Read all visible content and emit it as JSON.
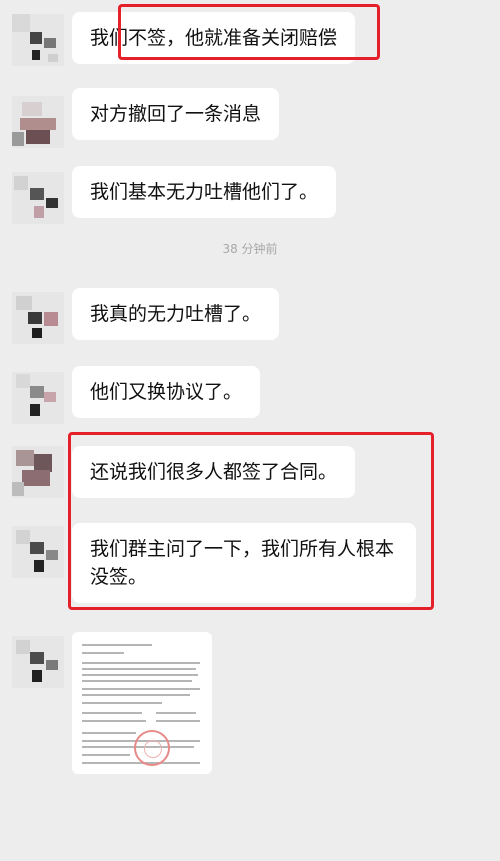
{
  "chat": {
    "messages": [
      {
        "text": "我们不签，他就准备关闭赔偿"
      },
      {
        "text": "对方撤回了一条消息"
      },
      {
        "text": "我们基本无力吐槽他们了。"
      },
      {
        "text": "我真的无力吐槽了。"
      },
      {
        "text": "他们又换协议了。"
      },
      {
        "text": "还说我们很多人都签了合同。"
      },
      {
        "text": "我们群主问了一下，我们所有人根本没签。"
      }
    ],
    "timestamp": "38 分钟前"
  },
  "colors": {
    "background": "#ededed",
    "bubble": "#ffffff",
    "highlight": "#e5202a",
    "timestamp": "#a8a8a8"
  }
}
